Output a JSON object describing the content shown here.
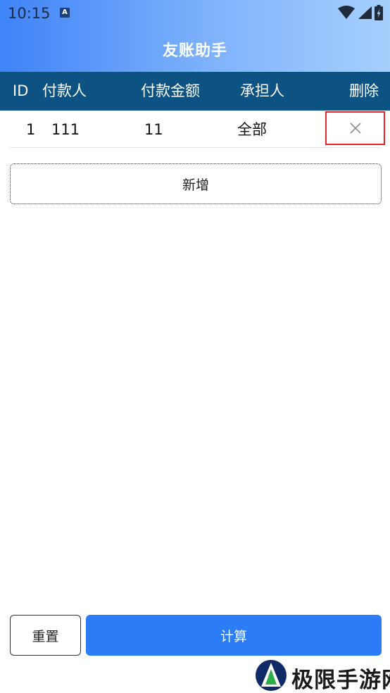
{
  "status_bar": {
    "time": "10:15",
    "notification_glyph": "A",
    "icons": [
      "wifi-icon",
      "signal-icon",
      "battery-icon"
    ]
  },
  "nav": {
    "title": "友账助手"
  },
  "table": {
    "headers": {
      "id": "ID",
      "payer": "付款人",
      "amount": "付款金额",
      "bearer": "承担人",
      "delete": "删除"
    },
    "rows": [
      {
        "id": "1",
        "payer": "111",
        "amount": "11",
        "bearer": "全部"
      }
    ]
  },
  "actions": {
    "add_label": "新增",
    "reset_label": "重置",
    "calculate_label": "计算"
  },
  "watermark": {
    "text": "极限手游网"
  },
  "colors": {
    "header_gradient_start": "#3f83f8",
    "header_gradient_end": "#a7cffd",
    "table_header": "#0c5282",
    "primary_button": "#2b7cf6",
    "delete_highlight": "#e1272c"
  }
}
